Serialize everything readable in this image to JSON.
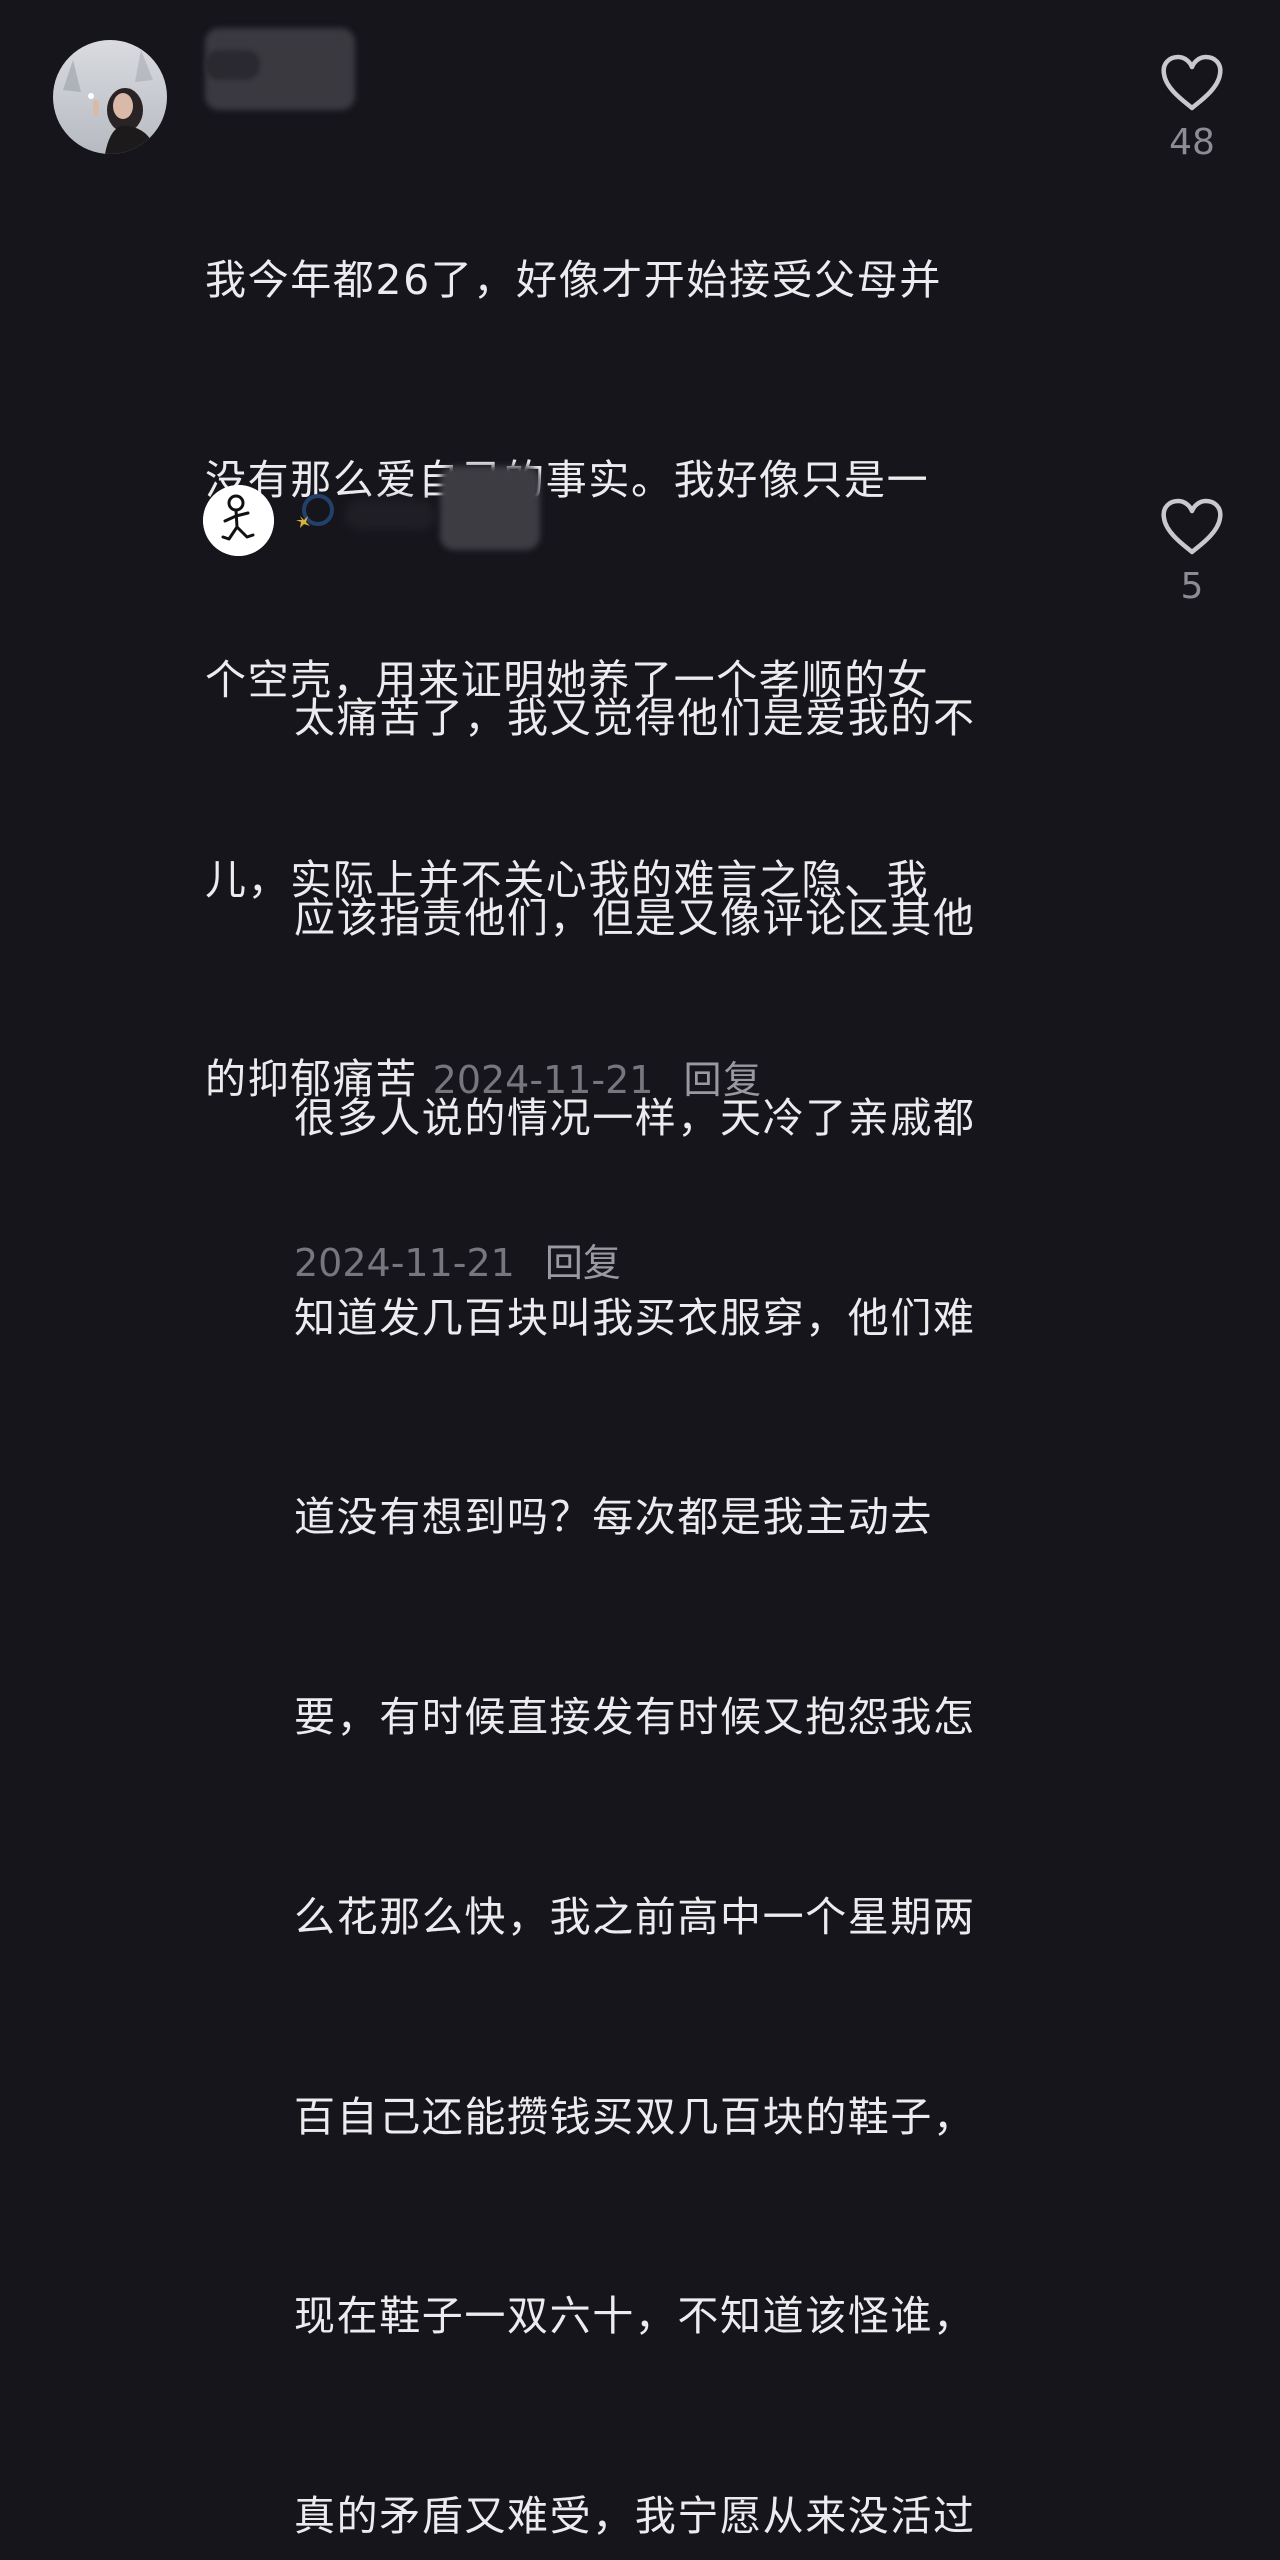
{
  "comments": [
    {
      "avatar": "photo-avatar",
      "author_name": "",
      "text_lines": [
        "我今年都26了，好像才开始接受父母并",
        "没有那么爱自己的事实。我好像只是一",
        "个空壳，用来证明她养了一个孝顺的女",
        "儿，实际上并不关心我的难言之隐、我",
        "的抑郁痛苦"
      ],
      "date": "2024-11-21",
      "reply_label": "回复",
      "likes": "48"
    },
    {
      "avatar": "stick-figure-avatar",
      "author_name": "",
      "text_lines": [
        "太痛苦了，我又觉得他们是爱我的不",
        "应该指责他们，但是又像评论区其他",
        "很多人说的情况一样，天冷了亲戚都",
        "知道发几百块叫我买衣服穿，他们难",
        "道没有想到吗？每次都是我主动去",
        "要，有时候直接发有时候又抱怨我怎",
        "么花那么快，我之前高中一个星期两",
        "百自己还能攒钱买双几百块的鞋子，",
        "现在鞋子一双六十，不知道该怪谁，",
        "真的矛盾又难受，我宁愿从来没活过"
      ],
      "date": "2024-11-21",
      "reply_label": "回复",
      "likes": "5"
    }
  ],
  "icons": {
    "like": "heart-outline-icon"
  },
  "colors": {
    "background": "#16151c",
    "text": "#ecebee",
    "meta": "#77757d",
    "icon": "#c9c8cd"
  }
}
